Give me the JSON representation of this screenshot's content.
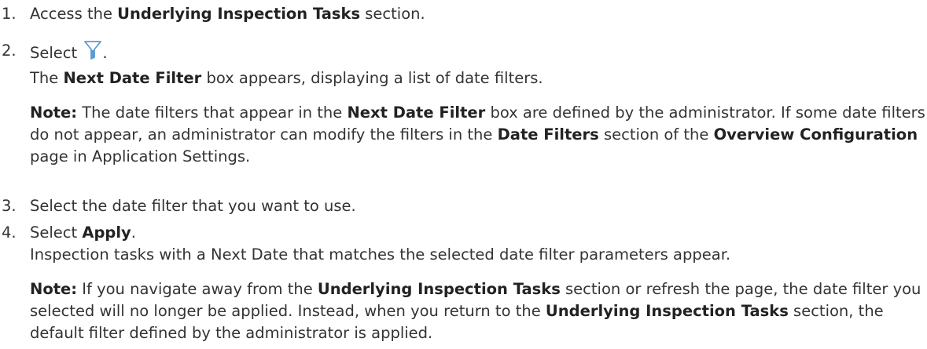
{
  "steps": [
    {
      "number": "1.",
      "parts": [
        "Access the ",
        "Underlying Inspection Tasks",
        " section."
      ]
    },
    {
      "number": "2.",
      "before_icon": "Select ",
      "icon": "filter-funnel-icon",
      "after_icon": ".",
      "info": [
        "The ",
        "Next Date Filter",
        " box appears, displaying a list of date filters."
      ],
      "note": [
        "Note:",
        " The date filters that appear in the ",
        "Next Date Filter",
        " box are defined by the administrator. If some date filters do not appear, an administrator can modify the filters in the ",
        "Date Filters",
        " section of the ",
        "Overview Configuration",
        " page in Application Settings."
      ]
    },
    {
      "number": "3.",
      "text": "Select the date filter that you want to use."
    },
    {
      "number": "4.",
      "parts": [
        "Select ",
        "Apply",
        "."
      ],
      "info": "Inspection tasks with a Next Date that matches the selected date filter parameters appear.",
      "note": [
        "Note:",
        " If you navigate away from the ",
        "Underlying Inspection Tasks",
        " section or refresh the page, the date filter you selected will no longer be applied. Instead, when you return to the ",
        "Underlying Inspection Tasks",
        " section, the default filter defined by the administrator is applied."
      ]
    }
  ],
  "colors": {
    "text": "#333333",
    "icon": "#5b9bd5"
  }
}
